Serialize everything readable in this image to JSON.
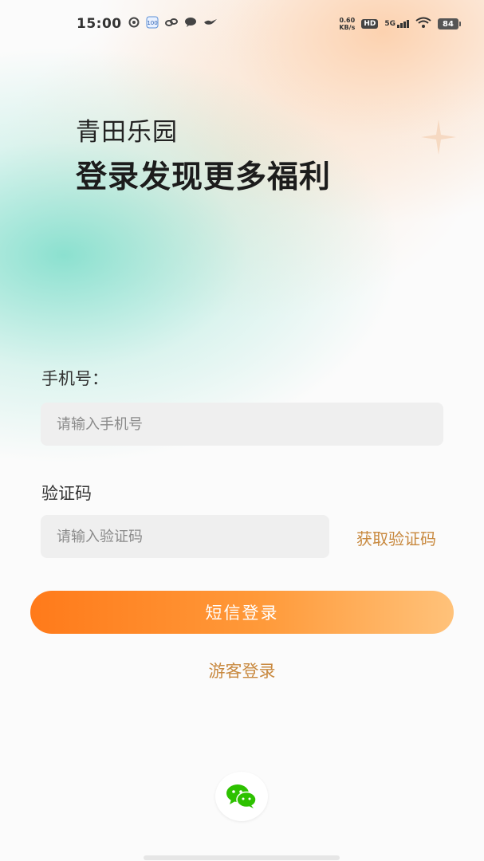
{
  "status_bar": {
    "time": "15:00",
    "net_speed_value": "0.60",
    "net_speed_unit": "KB/s",
    "hd_badge": "HD",
    "network": "5G",
    "battery": "84"
  },
  "header": {
    "app_name": "青田乐园",
    "headline": "登录发现更多福利"
  },
  "form": {
    "phone_label": "手机号：",
    "phone_placeholder": "请输入手机号",
    "code_label": "验证码",
    "code_placeholder": "请输入验证码",
    "get_code_label": "获取验证码",
    "sms_login_label": "短信登录",
    "guest_login_label": "游客登录"
  },
  "third_party": {
    "wechat_icon": "wechat-icon"
  },
  "colors": {
    "accent_orange": "#ff7a1a",
    "link_gold": "#c8893f",
    "wechat_green": "#2dc100"
  }
}
